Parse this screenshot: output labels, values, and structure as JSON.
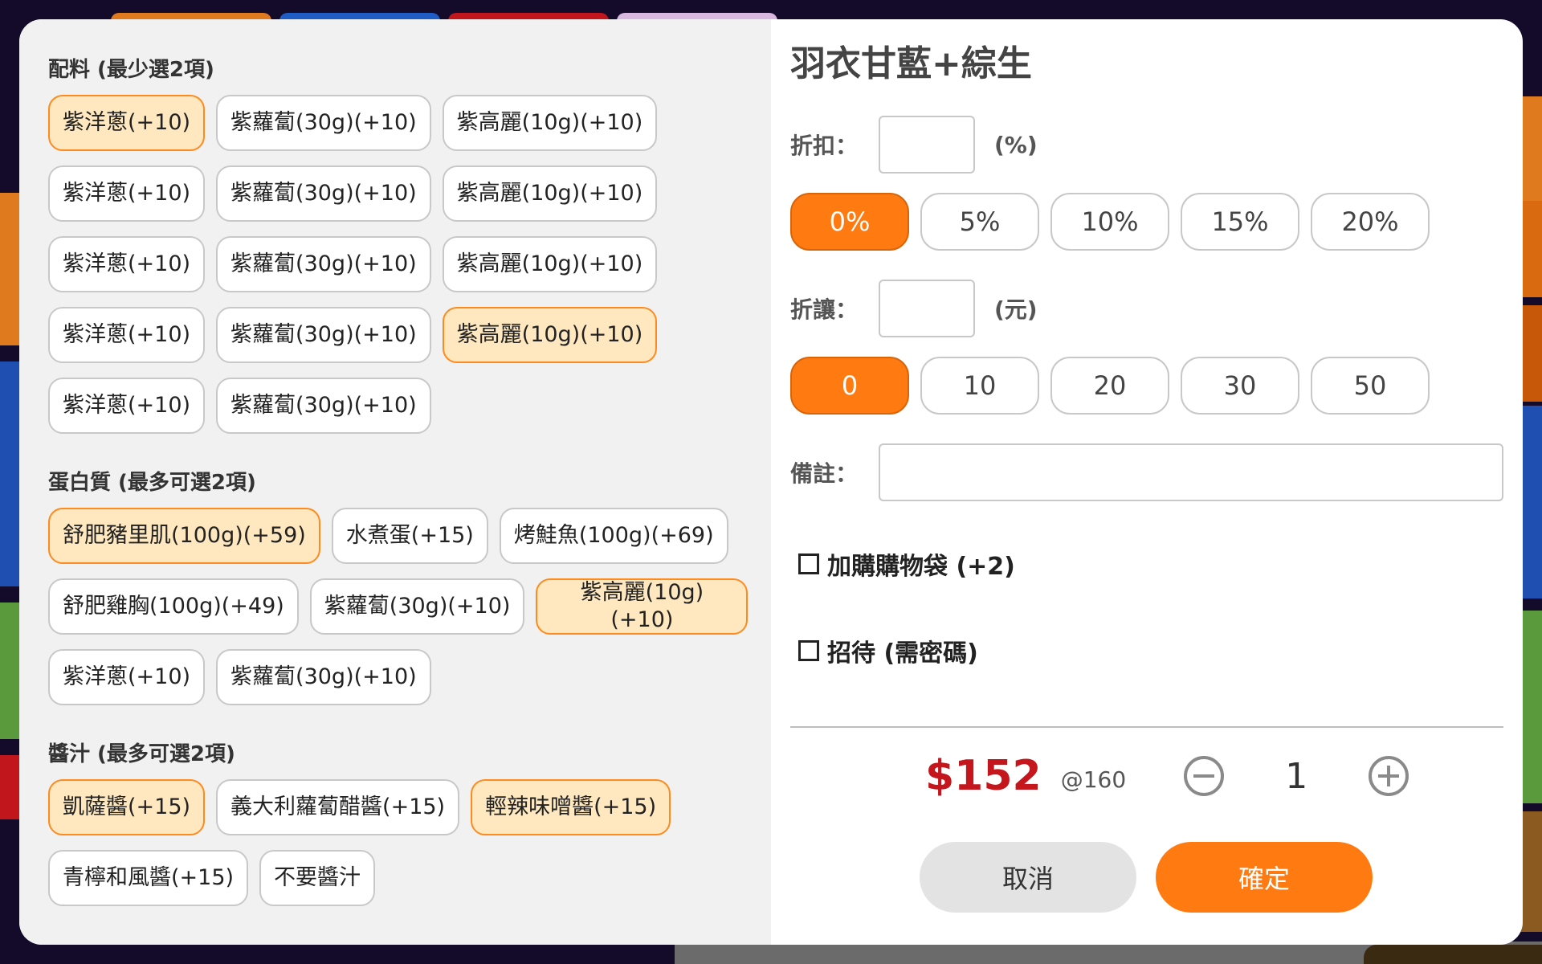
{
  "left": {
    "sections": [
      {
        "title": "配料 (最少選2項)",
        "chips": [
          {
            "label": "紫洋蔥(+10)",
            "selected": true
          },
          {
            "label": "紫蘿蔔(30g)(+10)",
            "selected": false
          },
          {
            "label": "紫高麗(10g)(+10)",
            "selected": false
          },
          {
            "label": "紫洋蔥(+10)",
            "selected": false
          },
          {
            "label": "紫蘿蔔(30g)(+10)",
            "selected": false
          },
          {
            "label": "紫高麗(10g)(+10)",
            "selected": false
          },
          {
            "label": "紫洋蔥(+10)",
            "selected": false
          },
          {
            "label": "紫蘿蔔(30g)(+10)",
            "selected": false
          },
          {
            "label": "紫高麗(10g)(+10)",
            "selected": false
          },
          {
            "label": "紫洋蔥(+10)",
            "selected": false
          },
          {
            "label": "紫蘿蔔(30g)(+10)",
            "selected": false
          },
          {
            "label": "紫高麗(10g)(+10)",
            "selected": true
          },
          {
            "label": "紫洋蔥(+10)",
            "selected": false
          },
          {
            "label": "紫蘿蔔(30g)(+10)",
            "selected": false
          }
        ]
      },
      {
        "title": "蛋白質 (最多可選2項)",
        "chips": [
          {
            "label": "舒肥豬里肌(100g)(+59)",
            "selected": true
          },
          {
            "label": "水煮蛋(+15)",
            "selected": false
          },
          {
            "label": "烤鮭魚(100g)(+69)",
            "selected": false
          },
          {
            "label": "舒肥雞胸(100g)(+49)",
            "selected": false
          },
          {
            "label": "紫蘿蔔(30g)(+10)",
            "selected": false
          },
          {
            "label": "紫高麗(10g)(+10)",
            "selected": true,
            "wrap": true
          },
          {
            "label": "紫洋蔥(+10)",
            "selected": false
          },
          {
            "label": "紫蘿蔔(30g)(+10)",
            "selected": false
          }
        ]
      },
      {
        "title": "醬汁 (最多可選2項)",
        "chips": [
          {
            "label": "凱薩醬(+15)",
            "selected": true
          },
          {
            "label": "義大利蘿蔔醋醬(+15)",
            "selected": false
          },
          {
            "label": "輕辣味噌醬(+15)",
            "selected": true
          },
          {
            "label": "青檸和風醬(+15)",
            "selected": false
          },
          {
            "label": "不要醬汁",
            "selected": false
          }
        ]
      }
    ]
  },
  "right": {
    "title": "羽衣甘藍+綜生",
    "discount_pct": {
      "label": "折扣：",
      "unit": "(%)",
      "options": [
        "0%",
        "5%",
        "10%",
        "15%",
        "20%"
      ],
      "active": 0
    },
    "discount_amt": {
      "label": "折讓：",
      "unit": "(元)",
      "options": [
        "0",
        "10",
        "20",
        "30",
        "50"
      ],
      "active": 0
    },
    "note_label": "備註：",
    "bag_label": "加購購物袋 (+2)",
    "treat_label": "招待 (需密碼)",
    "price": "$152",
    "unit_price": "@160",
    "quantity": "1",
    "cancel_label": "取消",
    "confirm_label": "確定"
  },
  "colors": {
    "accent": "#ff7a10",
    "selected_chip_bg": "#ffe8bf",
    "selected_chip_border": "#ff8a1e",
    "price": "#c4161c"
  }
}
